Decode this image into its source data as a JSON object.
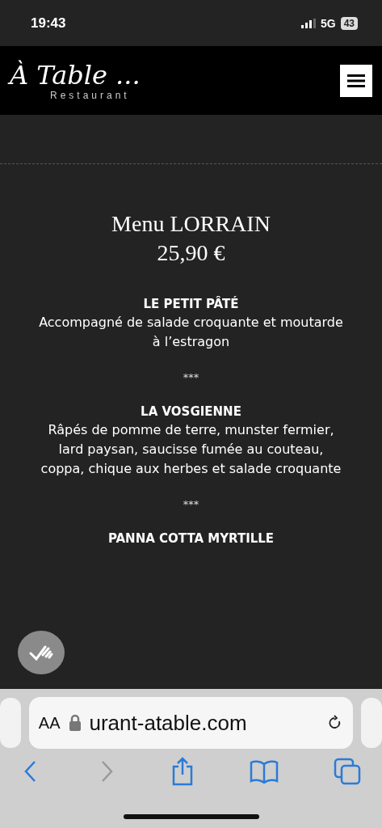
{
  "status_bar": {
    "time": "19:43",
    "network": "5G",
    "battery": "43"
  },
  "header": {
    "logo": "À Table ...",
    "logo_subtitle": "Restaurant"
  },
  "menu": {
    "title": "Menu LORRAIN",
    "price": "25,90 €",
    "items": [
      {
        "kind": "course",
        "name": "LE PETIT PÂTÉ",
        "description": "Accompagné de salade croquante et moutarde à l’estragon"
      },
      {
        "kind": "separator",
        "text": "***"
      },
      {
        "kind": "course",
        "name": "LA VOSGIENNE",
        "description": "Râpés de pomme de terre, munster fermier, lard paysan, saucisse fumée au couteau, coppa, chique aux herbes et salade croquante"
      },
      {
        "kind": "separator",
        "text": "***"
      },
      {
        "kind": "course",
        "name": "PANNA COTTA MYRTILLE"
      }
    ]
  },
  "browser": {
    "text_size": "AA",
    "url": "urant-atable.com",
    "back": {
      "disabled": false
    },
    "forward": {
      "disabled": true
    }
  }
}
